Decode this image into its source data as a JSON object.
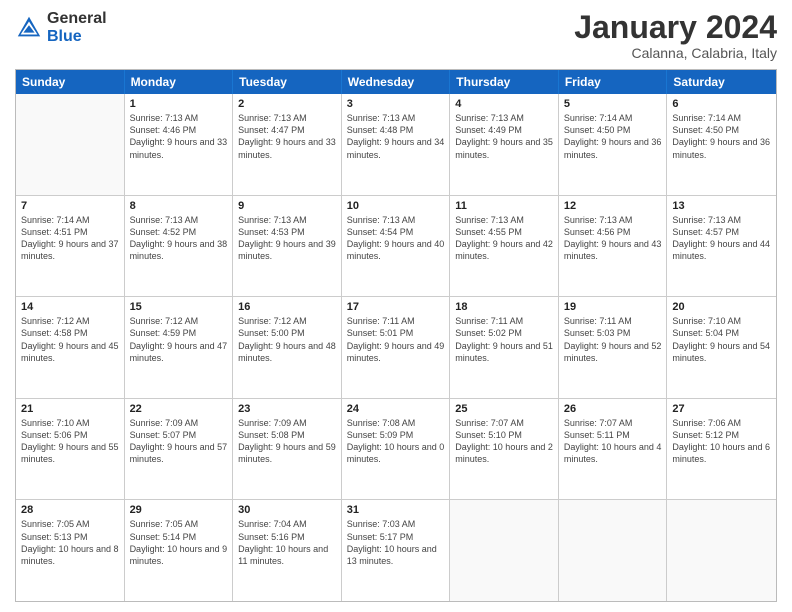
{
  "logo": {
    "general": "General",
    "blue": "Blue"
  },
  "title": "January 2024",
  "location": "Calanna, Calabria, Italy",
  "weekdays": [
    "Sunday",
    "Monday",
    "Tuesday",
    "Wednesday",
    "Thursday",
    "Friday",
    "Saturday"
  ],
  "weeks": [
    [
      {
        "day": "",
        "sunrise": "",
        "sunset": "",
        "daylight": ""
      },
      {
        "day": "1",
        "sunrise": "Sunrise: 7:13 AM",
        "sunset": "Sunset: 4:46 PM",
        "daylight": "Daylight: 9 hours and 33 minutes."
      },
      {
        "day": "2",
        "sunrise": "Sunrise: 7:13 AM",
        "sunset": "Sunset: 4:47 PM",
        "daylight": "Daylight: 9 hours and 33 minutes."
      },
      {
        "day": "3",
        "sunrise": "Sunrise: 7:13 AM",
        "sunset": "Sunset: 4:48 PM",
        "daylight": "Daylight: 9 hours and 34 minutes."
      },
      {
        "day": "4",
        "sunrise": "Sunrise: 7:13 AM",
        "sunset": "Sunset: 4:49 PM",
        "daylight": "Daylight: 9 hours and 35 minutes."
      },
      {
        "day": "5",
        "sunrise": "Sunrise: 7:14 AM",
        "sunset": "Sunset: 4:50 PM",
        "daylight": "Daylight: 9 hours and 36 minutes."
      },
      {
        "day": "6",
        "sunrise": "Sunrise: 7:14 AM",
        "sunset": "Sunset: 4:50 PM",
        "daylight": "Daylight: 9 hours and 36 minutes."
      }
    ],
    [
      {
        "day": "7",
        "sunrise": "Sunrise: 7:14 AM",
        "sunset": "Sunset: 4:51 PM",
        "daylight": "Daylight: 9 hours and 37 minutes."
      },
      {
        "day": "8",
        "sunrise": "Sunrise: 7:13 AM",
        "sunset": "Sunset: 4:52 PM",
        "daylight": "Daylight: 9 hours and 38 minutes."
      },
      {
        "day": "9",
        "sunrise": "Sunrise: 7:13 AM",
        "sunset": "Sunset: 4:53 PM",
        "daylight": "Daylight: 9 hours and 39 minutes."
      },
      {
        "day": "10",
        "sunrise": "Sunrise: 7:13 AM",
        "sunset": "Sunset: 4:54 PM",
        "daylight": "Daylight: 9 hours and 40 minutes."
      },
      {
        "day": "11",
        "sunrise": "Sunrise: 7:13 AM",
        "sunset": "Sunset: 4:55 PM",
        "daylight": "Daylight: 9 hours and 42 minutes."
      },
      {
        "day": "12",
        "sunrise": "Sunrise: 7:13 AM",
        "sunset": "Sunset: 4:56 PM",
        "daylight": "Daylight: 9 hours and 43 minutes."
      },
      {
        "day": "13",
        "sunrise": "Sunrise: 7:13 AM",
        "sunset": "Sunset: 4:57 PM",
        "daylight": "Daylight: 9 hours and 44 minutes."
      }
    ],
    [
      {
        "day": "14",
        "sunrise": "Sunrise: 7:12 AM",
        "sunset": "Sunset: 4:58 PM",
        "daylight": "Daylight: 9 hours and 45 minutes."
      },
      {
        "day": "15",
        "sunrise": "Sunrise: 7:12 AM",
        "sunset": "Sunset: 4:59 PM",
        "daylight": "Daylight: 9 hours and 47 minutes."
      },
      {
        "day": "16",
        "sunrise": "Sunrise: 7:12 AM",
        "sunset": "Sunset: 5:00 PM",
        "daylight": "Daylight: 9 hours and 48 minutes."
      },
      {
        "day": "17",
        "sunrise": "Sunrise: 7:11 AM",
        "sunset": "Sunset: 5:01 PM",
        "daylight": "Daylight: 9 hours and 49 minutes."
      },
      {
        "day": "18",
        "sunrise": "Sunrise: 7:11 AM",
        "sunset": "Sunset: 5:02 PM",
        "daylight": "Daylight: 9 hours and 51 minutes."
      },
      {
        "day": "19",
        "sunrise": "Sunrise: 7:11 AM",
        "sunset": "Sunset: 5:03 PM",
        "daylight": "Daylight: 9 hours and 52 minutes."
      },
      {
        "day": "20",
        "sunrise": "Sunrise: 7:10 AM",
        "sunset": "Sunset: 5:04 PM",
        "daylight": "Daylight: 9 hours and 54 minutes."
      }
    ],
    [
      {
        "day": "21",
        "sunrise": "Sunrise: 7:10 AM",
        "sunset": "Sunset: 5:06 PM",
        "daylight": "Daylight: 9 hours and 55 minutes."
      },
      {
        "day": "22",
        "sunrise": "Sunrise: 7:09 AM",
        "sunset": "Sunset: 5:07 PM",
        "daylight": "Daylight: 9 hours and 57 minutes."
      },
      {
        "day": "23",
        "sunrise": "Sunrise: 7:09 AM",
        "sunset": "Sunset: 5:08 PM",
        "daylight": "Daylight: 9 hours and 59 minutes."
      },
      {
        "day": "24",
        "sunrise": "Sunrise: 7:08 AM",
        "sunset": "Sunset: 5:09 PM",
        "daylight": "Daylight: 10 hours and 0 minutes."
      },
      {
        "day": "25",
        "sunrise": "Sunrise: 7:07 AM",
        "sunset": "Sunset: 5:10 PM",
        "daylight": "Daylight: 10 hours and 2 minutes."
      },
      {
        "day": "26",
        "sunrise": "Sunrise: 7:07 AM",
        "sunset": "Sunset: 5:11 PM",
        "daylight": "Daylight: 10 hours and 4 minutes."
      },
      {
        "day": "27",
        "sunrise": "Sunrise: 7:06 AM",
        "sunset": "Sunset: 5:12 PM",
        "daylight": "Daylight: 10 hours and 6 minutes."
      }
    ],
    [
      {
        "day": "28",
        "sunrise": "Sunrise: 7:05 AM",
        "sunset": "Sunset: 5:13 PM",
        "daylight": "Daylight: 10 hours and 8 minutes."
      },
      {
        "day": "29",
        "sunrise": "Sunrise: 7:05 AM",
        "sunset": "Sunset: 5:14 PM",
        "daylight": "Daylight: 10 hours and 9 minutes."
      },
      {
        "day": "30",
        "sunrise": "Sunrise: 7:04 AM",
        "sunset": "Sunset: 5:16 PM",
        "daylight": "Daylight: 10 hours and 11 minutes."
      },
      {
        "day": "31",
        "sunrise": "Sunrise: 7:03 AM",
        "sunset": "Sunset: 5:17 PM",
        "daylight": "Daylight: 10 hours and 13 minutes."
      },
      {
        "day": "",
        "sunrise": "",
        "sunset": "",
        "daylight": ""
      },
      {
        "day": "",
        "sunrise": "",
        "sunset": "",
        "daylight": ""
      },
      {
        "day": "",
        "sunrise": "",
        "sunset": "",
        "daylight": ""
      }
    ]
  ]
}
